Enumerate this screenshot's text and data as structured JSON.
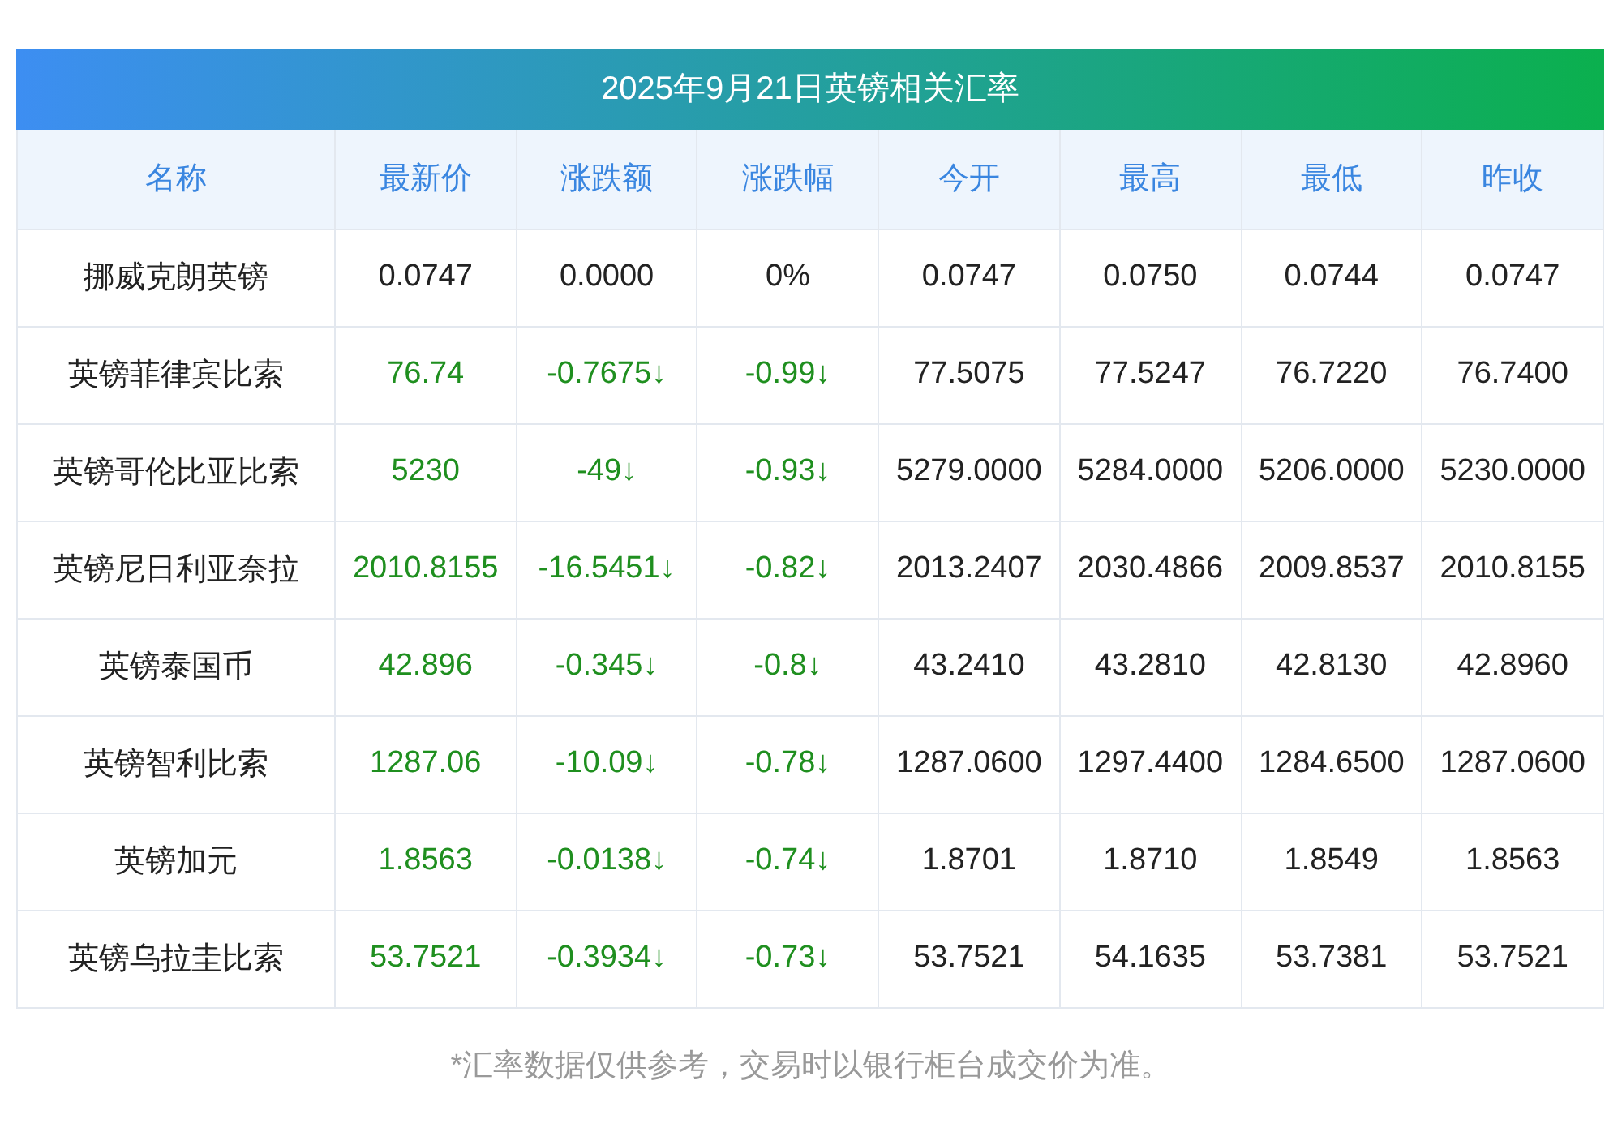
{
  "title": "2025年9月21日英镑相关汇率",
  "columns": [
    "名称",
    "最新价",
    "涨跌额",
    "涨跌幅",
    "今开",
    "最高",
    "最低",
    "昨收"
  ],
  "rows": [
    {
      "falling": false,
      "cells": [
        "挪威克朗英镑",
        "0.0747",
        "0.0000",
        "0%",
        "0.0747",
        "0.0750",
        "0.0744",
        "0.0747"
      ]
    },
    {
      "falling": true,
      "cells": [
        "英镑菲律宾比索",
        "76.74",
        "-0.7675↓",
        "-0.99↓",
        "77.5075",
        "77.5247",
        "76.7220",
        "76.7400"
      ]
    },
    {
      "falling": true,
      "cells": [
        "英镑哥伦比亚比索",
        "5230",
        "-49↓",
        "-0.93↓",
        "5279.0000",
        "5284.0000",
        "5206.0000",
        "5230.0000"
      ]
    },
    {
      "falling": true,
      "cells": [
        "英镑尼日利亚奈拉",
        "2010.8155",
        "-16.5451↓",
        "-0.82↓",
        "2013.2407",
        "2030.4866",
        "2009.8537",
        "2010.8155"
      ]
    },
    {
      "falling": true,
      "cells": [
        "英镑泰国币",
        "42.896",
        "-0.345↓",
        "-0.8↓",
        "43.2410",
        "43.2810",
        "42.8130",
        "42.8960"
      ]
    },
    {
      "falling": true,
      "cells": [
        "英镑智利比索",
        "1287.06",
        "-10.09↓",
        "-0.78↓",
        "1287.0600",
        "1297.4400",
        "1284.6500",
        "1287.0600"
      ]
    },
    {
      "falling": true,
      "cells": [
        "英镑加元",
        "1.8563",
        "-0.0138↓",
        "-0.74↓",
        "1.8701",
        "1.8710",
        "1.8549",
        "1.8563"
      ]
    },
    {
      "falling": true,
      "cells": [
        "英镑乌拉圭比索",
        "53.7521",
        "-0.3934↓",
        "-0.73↓",
        "53.7521",
        "54.1635",
        "53.7381",
        "53.7521"
      ]
    }
  ],
  "footnote": "*汇率数据仅供参考，交易时以银行柜台成交价为准。"
}
